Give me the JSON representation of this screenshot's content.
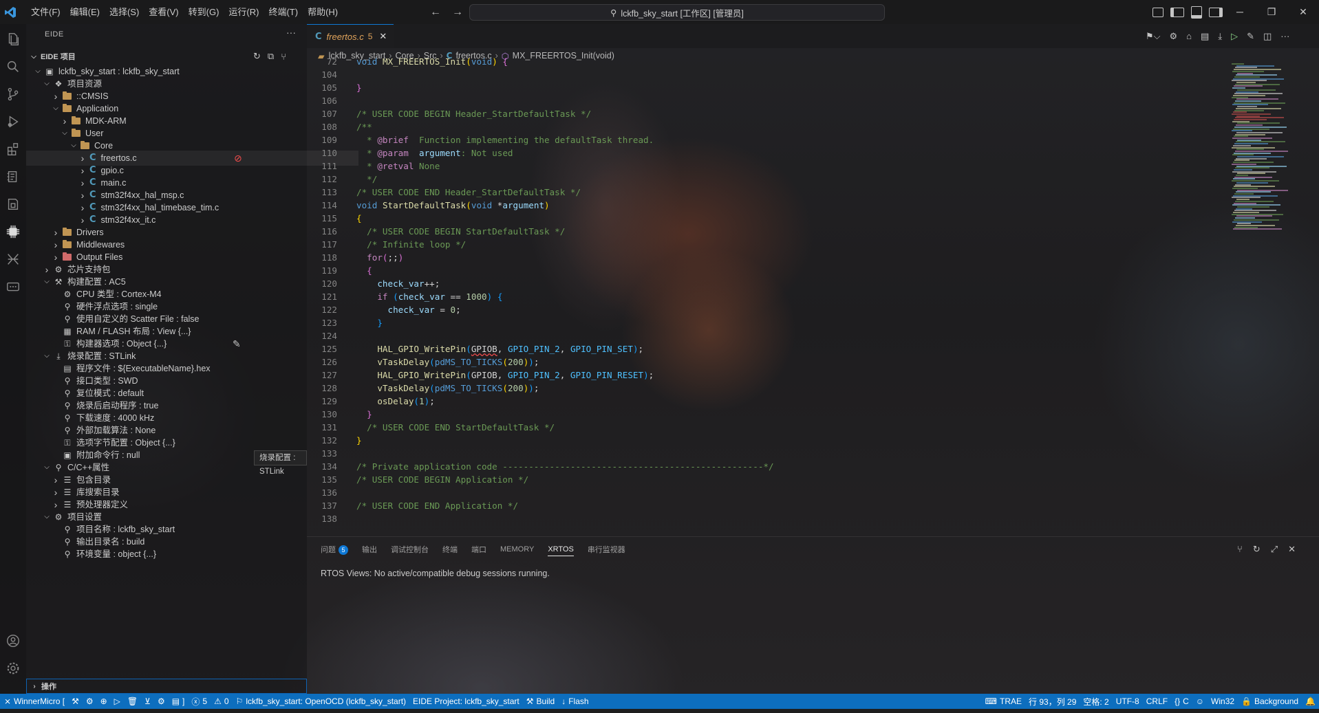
{
  "menu": [
    "文件(F)",
    "编辑(E)",
    "选择(S)",
    "查看(V)",
    "转到(G)",
    "运行(R)",
    "终端(T)",
    "帮助(H)"
  ],
  "window_title": "lckfb_sky_start [工作区] [管理员]",
  "colors": {
    "accent": "#0e78d5",
    "statusbar": "#0d6ebe",
    "folder": "#c09553",
    "c_file": "#519aba",
    "tab_modified": "#e0a35b"
  },
  "sidebar": {
    "header": "EIDE",
    "section_title": "EIDE 项目",
    "tooltip": "烧录配置 : STLink",
    "ops_label": "操作",
    "tree": [
      {
        "label": "lckfb_sky_start : lckfb_sky_start",
        "icon": "project-icon",
        "level": 0,
        "state": "open"
      },
      {
        "label": "项目资源",
        "icon": "resources-icon",
        "level": 1,
        "state": "open"
      },
      {
        "label": "::CMSIS",
        "icon": "folder-icon",
        "level": 2,
        "state": "closed"
      },
      {
        "label": "Application",
        "icon": "folder-icon",
        "level": 2,
        "state": "open"
      },
      {
        "label": "MDK-ARM",
        "icon": "folder-icon",
        "level": 3,
        "state": "closed"
      },
      {
        "label": "User",
        "icon": "folder-icon",
        "level": 3,
        "state": "open"
      },
      {
        "label": "Core",
        "icon": "folder-icon",
        "level": 4,
        "state": "open"
      },
      {
        "label": "freertos.c",
        "icon": "c-file-icon",
        "level": 5,
        "state": "closed",
        "selected": true
      },
      {
        "label": "gpio.c",
        "icon": "c-file-icon",
        "level": 5,
        "state": "closed"
      },
      {
        "label": "main.c",
        "icon": "c-file-icon",
        "level": 5,
        "state": "closed"
      },
      {
        "label": "stm32f4xx_hal_msp.c",
        "icon": "c-file-icon",
        "level": 5,
        "state": "closed"
      },
      {
        "label": "stm32f4xx_hal_timebase_tim.c",
        "icon": "c-file-icon",
        "level": 5,
        "state": "closed"
      },
      {
        "label": "stm32f4xx_it.c",
        "icon": "c-file-icon",
        "level": 5,
        "state": "closed"
      },
      {
        "label": "Drivers",
        "icon": "folder-icon",
        "level": 2,
        "state": "closed"
      },
      {
        "label": "Middlewares",
        "icon": "folder-icon",
        "level": 2,
        "state": "closed"
      },
      {
        "label": "Output Files",
        "icon": "output-folder-icon",
        "level": 2,
        "state": "closed"
      },
      {
        "label": "芯片支持包",
        "icon": "chip-icon",
        "level": 1,
        "state": "closed"
      },
      {
        "label": "构建配置 : AC5",
        "icon": "build-config-icon",
        "level": 1,
        "state": "open"
      },
      {
        "label": "CPU 类型 : Cortex-M4",
        "icon": "cpu-icon",
        "level": 2,
        "state": "none"
      },
      {
        "label": "硬件浮点选项 : single",
        "icon": "wrench-icon",
        "level": 2,
        "state": "none"
      },
      {
        "label": "使用自定义的 Scatter File : false",
        "icon": "wrench-icon",
        "level": 2,
        "state": "none"
      },
      {
        "label": "RAM / FLASH 布局 : View {...}",
        "icon": "memory-icon",
        "level": 2,
        "state": "none"
      },
      {
        "label": "构建器选项 : Object {...}",
        "icon": "options-icon",
        "level": 2,
        "state": "none",
        "edit": true
      },
      {
        "label": "烧录配置 : STLink",
        "icon": "flash-config-icon",
        "level": 1,
        "state": "open"
      },
      {
        "label": "程序文件 : ${ExecutableName}.hex",
        "icon": "file-icon",
        "level": 2,
        "state": "none"
      },
      {
        "label": "接口类型 : SWD",
        "icon": "wrench-icon",
        "level": 2,
        "state": "none"
      },
      {
        "label": "复位模式 : default",
        "icon": "wrench-icon",
        "level": 2,
        "state": "none"
      },
      {
        "label": "烧录后启动程序 : true",
        "icon": "wrench-icon",
        "level": 2,
        "state": "none"
      },
      {
        "label": "下载速度 : 4000 kHz",
        "icon": "wrench-icon",
        "level": 2,
        "state": "none"
      },
      {
        "label": "外部加载算法 : None",
        "icon": "wrench-icon",
        "level": 2,
        "state": "none"
      },
      {
        "label": "选项字节配置 : Object {...}",
        "icon": "options-icon",
        "level": 2,
        "state": "none"
      },
      {
        "label": "附加命令行 : null",
        "icon": "terminal-icon",
        "level": 2,
        "state": "none"
      },
      {
        "label": "C/C++属性",
        "icon": "wrench-icon",
        "level": 1,
        "state": "open"
      },
      {
        "label": "包含目录",
        "icon": "list-icon",
        "level": 2,
        "state": "closed"
      },
      {
        "label": "库搜索目录",
        "icon": "list-icon",
        "level": 2,
        "state": "closed"
      },
      {
        "label": "预处理器定义",
        "icon": "list-icon",
        "level": 2,
        "state": "closed"
      },
      {
        "label": "项目设置",
        "icon": "settings-icon",
        "level": 1,
        "state": "open"
      },
      {
        "label": "项目名称 : lckfb_sky_start",
        "icon": "wrench-icon",
        "level": 2,
        "state": "none"
      },
      {
        "label": "输出目录名 : build",
        "icon": "wrench-icon",
        "level": 2,
        "state": "none"
      },
      {
        "label": "环境变量 : object {...}",
        "icon": "wrench-icon",
        "level": 2,
        "state": "none"
      }
    ]
  },
  "editor": {
    "tab": {
      "name": "freertos.c",
      "problems": "5"
    },
    "breadcrumb": [
      "lckfb_sky_start",
      "Core",
      "Src",
      "freertos.c",
      "MX_FREERTOS_Init(void)"
    ],
    "lines": [
      {
        "n": "72",
        "t": [
          [
            "kw",
            "void"
          ],
          [
            "tx",
            " "
          ],
          [
            "fn",
            "MX_FREERTOS_Init"
          ],
          [
            "pn",
            "("
          ],
          [
            "kw",
            "void"
          ],
          [
            "pn",
            ")"
          ],
          [
            "tx",
            " "
          ],
          [
            "pn2",
            "{"
          ]
        ]
      },
      {
        "n": "104",
        "t": []
      },
      {
        "n": "105",
        "t": [
          [
            "pn2",
            "}"
          ]
        ]
      },
      {
        "n": "106",
        "t": []
      },
      {
        "n": "107",
        "t": [
          [
            "cm",
            "/* USER CODE BEGIN Header_StartDefaultTask */"
          ]
        ]
      },
      {
        "n": "108",
        "t": [
          [
            "cm",
            "/**"
          ]
        ]
      },
      {
        "n": "109",
        "t": [
          [
            "cm",
            "  * "
          ],
          [
            "ctl",
            "@brief"
          ],
          [
            "cm",
            "  Function implementing the defaultTask thread."
          ]
        ]
      },
      {
        "n": "110",
        "t": [
          [
            "cm",
            "  * "
          ],
          [
            "ctl",
            "@param"
          ],
          [
            "cm",
            "  "
          ],
          [
            "var",
            "argument"
          ],
          [
            "cm",
            ": Not used"
          ]
        ]
      },
      {
        "n": "111",
        "t": [
          [
            "cm",
            "  * "
          ],
          [
            "ctl",
            "@retval"
          ],
          [
            "cm",
            " None"
          ]
        ]
      },
      {
        "n": "112",
        "t": [
          [
            "cm",
            "  */"
          ]
        ]
      },
      {
        "n": "113",
        "t": [
          [
            "cm",
            "/* USER CODE END Header_StartDefaultTask */"
          ]
        ]
      },
      {
        "n": "114",
        "t": [
          [
            "kw",
            "void"
          ],
          [
            "tx",
            " "
          ],
          [
            "fn",
            "StartDefaultTask"
          ],
          [
            "pn",
            "("
          ],
          [
            "kw",
            "void"
          ],
          [
            "tx",
            " *"
          ],
          [
            "var",
            "argument"
          ],
          [
            "pn",
            ")"
          ]
        ]
      },
      {
        "n": "115",
        "t": [
          [
            "pn",
            "{"
          ]
        ]
      },
      {
        "n": "116",
        "t": [
          [
            "tx",
            "  "
          ],
          [
            "cm",
            "/* USER CODE BEGIN StartDefaultTask */"
          ]
        ]
      },
      {
        "n": "117",
        "t": [
          [
            "tx",
            "  "
          ],
          [
            "cm",
            "/* Infinite loop */"
          ]
        ]
      },
      {
        "n": "118",
        "t": [
          [
            "tx",
            "  "
          ],
          [
            "ctl",
            "for"
          ],
          [
            "pn2",
            "("
          ],
          [
            "tx",
            ";;"
          ],
          [
            "pn2",
            ")"
          ]
        ]
      },
      {
        "n": "119",
        "t": [
          [
            "tx",
            "  "
          ],
          [
            "pn2",
            "{"
          ]
        ]
      },
      {
        "n": "120",
        "t": [
          [
            "tx",
            "    "
          ],
          [
            "var",
            "check_var"
          ],
          [
            "tx",
            "++;"
          ]
        ]
      },
      {
        "n": "121",
        "t": [
          [
            "tx",
            "    "
          ],
          [
            "ctl",
            "if"
          ],
          [
            "tx",
            " "
          ],
          [
            "pn3",
            "("
          ],
          [
            "var",
            "check_var"
          ],
          [
            "tx",
            " == "
          ],
          [
            "nm",
            "1000"
          ],
          [
            "pn3",
            ")"
          ],
          [
            "tx",
            " "
          ],
          [
            "pn3",
            "{"
          ]
        ]
      },
      {
        "n": "122",
        "t": [
          [
            "tx",
            "      "
          ],
          [
            "var",
            "check_var"
          ],
          [
            "tx",
            " = "
          ],
          [
            "nm",
            "0"
          ],
          [
            "tx",
            ";"
          ]
        ]
      },
      {
        "n": "123",
        "t": [
          [
            "tx",
            "    "
          ],
          [
            "pn3",
            "}"
          ]
        ]
      },
      {
        "n": "124",
        "t": []
      },
      {
        "n": "125",
        "t": [
          [
            "tx",
            "    "
          ],
          [
            "fn",
            "HAL_GPIO_WritePin"
          ],
          [
            "pn3",
            "("
          ],
          [
            "sq",
            "GPIOB"
          ],
          [
            "tx",
            ", "
          ],
          [
            "cst",
            "GPIO_PIN_2"
          ],
          [
            "tx",
            ", "
          ],
          [
            "cst",
            "GPIO_PIN_SET"
          ],
          [
            "pn3",
            ")"
          ],
          [
            "tx",
            ";"
          ]
        ]
      },
      {
        "n": "126",
        "t": [
          [
            "tx",
            "    "
          ],
          [
            "fn",
            "vTaskDelay"
          ],
          [
            "pn3",
            "("
          ],
          [
            "tag",
            "pdMS_TO_TICKS"
          ],
          [
            "pn",
            "("
          ],
          [
            "nm",
            "200"
          ],
          [
            "pn",
            ")"
          ],
          [
            "pn3",
            ")"
          ],
          [
            "tx",
            ";"
          ]
        ]
      },
      {
        "n": "127",
        "t": [
          [
            "tx",
            "    "
          ],
          [
            "fn",
            "HAL_GPIO_WritePin"
          ],
          [
            "pn3",
            "("
          ],
          [
            "tx",
            "GPIOB, "
          ],
          [
            "cst",
            "GPIO_PIN_2"
          ],
          [
            "tx",
            ", "
          ],
          [
            "cst",
            "GPIO_PIN_RESET"
          ],
          [
            "pn3",
            ")"
          ],
          [
            "tx",
            ";"
          ]
        ]
      },
      {
        "n": "128",
        "t": [
          [
            "tx",
            "    "
          ],
          [
            "fn",
            "vTaskDelay"
          ],
          [
            "pn3",
            "("
          ],
          [
            "tag",
            "pdMS_TO_TICKS"
          ],
          [
            "pn",
            "("
          ],
          [
            "nm",
            "200"
          ],
          [
            "pn",
            ")"
          ],
          [
            "pn3",
            ")"
          ],
          [
            "tx",
            ";"
          ]
        ]
      },
      {
        "n": "129",
        "t": [
          [
            "tx",
            "    "
          ],
          [
            "fn",
            "osDelay"
          ],
          [
            "pn3",
            "("
          ],
          [
            "nm",
            "1"
          ],
          [
            "pn3",
            ")"
          ],
          [
            "tx",
            ";"
          ]
        ]
      },
      {
        "n": "130",
        "t": [
          [
            "tx",
            "  "
          ],
          [
            "pn2",
            "}"
          ]
        ]
      },
      {
        "n": "131",
        "t": [
          [
            "tx",
            "  "
          ],
          [
            "cm",
            "/* USER CODE END StartDefaultTask */"
          ]
        ]
      },
      {
        "n": "132",
        "t": [
          [
            "pn",
            "}"
          ]
        ]
      },
      {
        "n": "133",
        "t": []
      },
      {
        "n": "134",
        "t": [
          [
            "cm",
            "/* Private application code --------------------------------------------------*/"
          ]
        ]
      },
      {
        "n": "135",
        "t": [
          [
            "cm",
            "/* USER CODE BEGIN Application */"
          ]
        ]
      },
      {
        "n": "136",
        "t": []
      },
      {
        "n": "137",
        "t": [
          [
            "cm",
            "/* USER CODE END Application */"
          ]
        ]
      },
      {
        "n": "138",
        "t": []
      }
    ]
  },
  "panel": {
    "tabs": [
      {
        "label": "问题",
        "badge": "5"
      },
      {
        "label": "输出"
      },
      {
        "label": "调试控制台"
      },
      {
        "label": "终端"
      },
      {
        "label": "端口"
      },
      {
        "label": "MEMORY"
      },
      {
        "label": "XRTOS",
        "active": true
      },
      {
        "label": "串行监视器"
      }
    ],
    "message": "RTOS Views: No active/compatible debug sessions running."
  },
  "statusbar": {
    "left": [
      {
        "label": "WinnerMicro [",
        "icon": "remote-icon"
      },
      {
        "label": "",
        "icon": "build-icon"
      },
      {
        "label": "",
        "icon": "gear-icon"
      },
      {
        "label": "",
        "icon": "globe-icon"
      },
      {
        "label": "",
        "icon": "play-icon"
      },
      {
        "label": "",
        "icon": "trash-icon"
      },
      {
        "label": "",
        "icon": "download-icon"
      },
      {
        "label": "",
        "icon": "chip-icon"
      },
      {
        "label": "]",
        "icon": "document-icon"
      },
      {
        "label": "5",
        "icon": "error-icon"
      },
      {
        "label": "0",
        "icon": "warning-icon"
      },
      {
        "label": "lckfb_sky_start: OpenOCD (lckfb_sky_start)",
        "icon": "debug-icon"
      },
      {
        "label": "EIDE Project: lckfb_sky_start",
        "icon": ""
      },
      {
        "label": "Build",
        "icon": "build-icon"
      },
      {
        "label": "Flash",
        "icon": "flash-icon"
      }
    ],
    "right": [
      {
        "label": "TRAE",
        "icon": "keyboard-icon"
      },
      {
        "label": "行 93，列 29",
        "icon": ""
      },
      {
        "label": "空格: 2",
        "icon": ""
      },
      {
        "label": "UTF-8",
        "icon": ""
      },
      {
        "label": "CRLF",
        "icon": ""
      },
      {
        "label": "C",
        "icon": "braces-icon"
      },
      {
        "label": "",
        "icon": "copilot-icon"
      },
      {
        "label": "Win32",
        "icon": ""
      },
      {
        "label": "Background",
        "icon": "lock-icon"
      },
      {
        "label": "",
        "icon": "bell-icon"
      }
    ]
  }
}
